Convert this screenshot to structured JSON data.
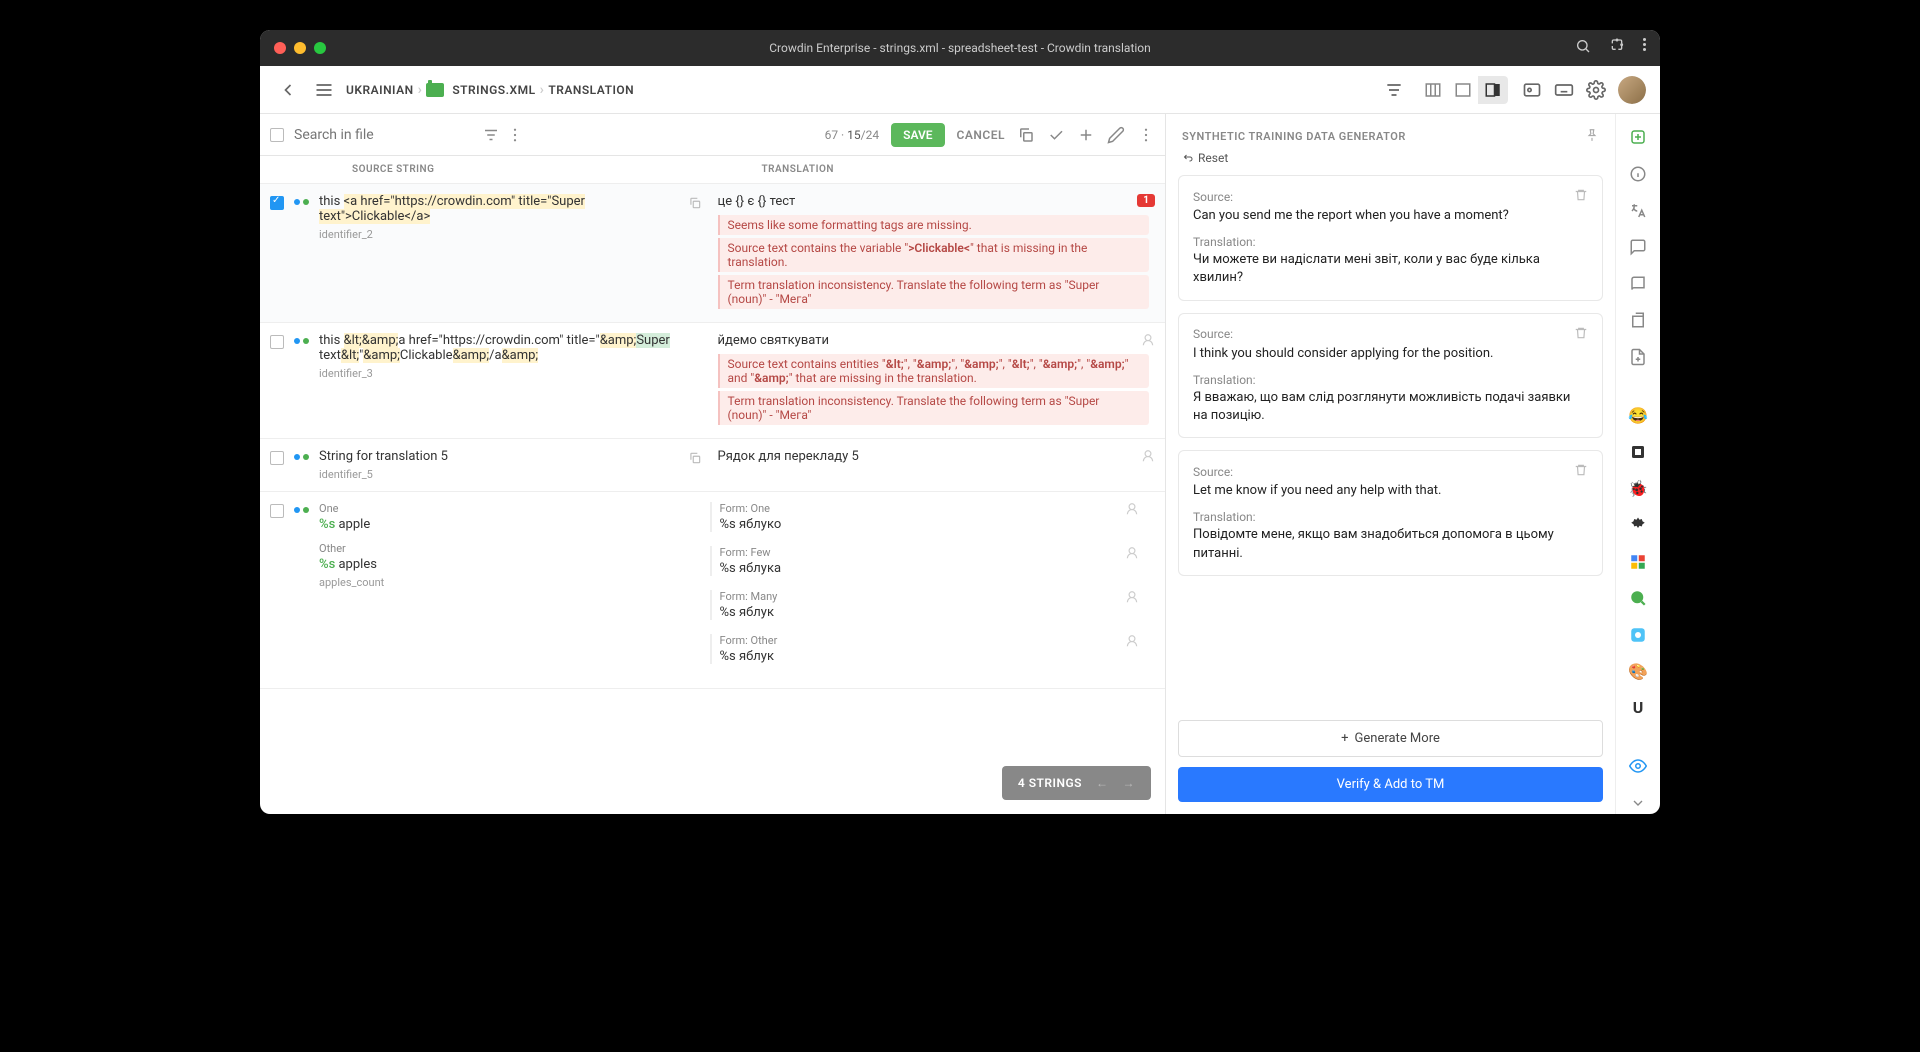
{
  "window_title": "Crowdin Enterprise - strings.xml - spreadsheet-test - Crowdin translation",
  "breadcrumbs": {
    "lang": "UKRAINIAN",
    "file": "STRINGS.XML",
    "mode": "TRANSLATION"
  },
  "search_placeholder": "Search in file",
  "counter": {
    "chars": "67",
    "current": "15",
    "total": "24"
  },
  "buttons": {
    "save": "SAVE",
    "cancel": "CANCEL",
    "generate_more": "Generate More",
    "verify": "Verify & Add to TM",
    "reset": "Reset"
  },
  "columns": {
    "source": "SOURCE STRING",
    "translation": "TRANSLATION"
  },
  "strings_bar": {
    "label": "4 STRINGS"
  },
  "panel_title": "SYNTHETIC TRAINING DATA GENERATOR",
  "labels": {
    "source": "Source:",
    "translation": "Translation:",
    "form_one": "Form: One",
    "form_few": "Form: Few",
    "form_many": "Form: Many",
    "form_other": "Form: Other",
    "one": "One",
    "other": "Other"
  },
  "rows": [
    {
      "checked": true,
      "source_prefix": "this ",
      "source_hl": "<a href=\"https://crowdin.com\" title=\"Super text\">Clickable</a>",
      "identifier": "identifier_2",
      "translation": "це {} є {} тест",
      "error_badge": "1",
      "warnings": [
        "Seems like some formatting tags are missing.",
        "Source text contains the variable \">Clickable<\" that is missing in the translation.",
        "Term translation inconsistency. Translate the following term as \"Super (noun)\" - \"Мега\""
      ]
    },
    {
      "checked": false,
      "source_html": "this &lt;&amp;a href=\"https://crowdin.com\" title=\"&amp;Super text&lt;\"&amp;Clickable&amp;/a&amp;",
      "identifier": "identifier_3",
      "translation": "йдемо святкувати",
      "warnings": [
        "Source text contains entities \"&lt;\", \"&amp;\", \"&amp;\", \"&lt;\", \"&amp;\", \"&amp;\" and \"&amp;\" that are missing in the translation.",
        "Term translation inconsistency. Translate the following term as \"Super (noun)\" - \"Мега\""
      ]
    },
    {
      "checked": false,
      "source": "String for translation 5",
      "identifier": "identifier_5",
      "translation": "Рядок для перекладу 5"
    },
    {
      "checked": false,
      "plural_source": {
        "one": "%s apple",
        "other": "%s apples"
      },
      "identifier": "apples_count",
      "plural_translation": {
        "one": "%s яблуко",
        "few": "%s яблука",
        "many": "%s яблук",
        "other": "%s яблук"
      }
    }
  ],
  "cards": [
    {
      "source": "Can you send me the report when you have a moment?",
      "translation": "Чи можете ви надіслати мені звіт, коли у вас буде кілька хвилин?"
    },
    {
      "source": "I think you should consider applying for the position.",
      "translation": "Я вважаю, що вам слід розглянути можливість подачі заявки на позицію."
    },
    {
      "source": "Let me know if you need any help with that.",
      "translation": "Повідомте мене, якщо вам знадобиться допомога в цьому питанні."
    }
  ],
  "rail_emoji": {
    "laugh": "😂",
    "bug": "🐞",
    "blue": "🌐",
    "wheel": "🎨",
    "u": "U"
  }
}
